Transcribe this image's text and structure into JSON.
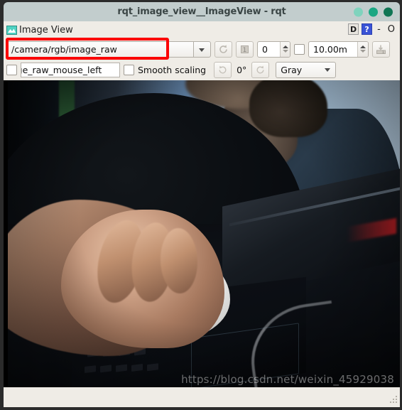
{
  "window": {
    "title": "rqt_image_view__ImageView - rqt",
    "controls": [
      {
        "name": "minimize",
        "color": "#7fd3bd"
      },
      {
        "name": "maximize",
        "color": "#1aa783"
      },
      {
        "name": "close",
        "color": "#0f7554"
      }
    ]
  },
  "dock": {
    "icon": "image-view-icon",
    "title": "Image View",
    "buttons": {
      "detach_label": "D",
      "help_label": "?",
      "minimize_label": "-",
      "close_label": "O"
    }
  },
  "toolbar_row1": {
    "topic_combo": {
      "value": "/camera/rgb/image_raw",
      "placeholder": "/camera/rgb/image_raw"
    },
    "refresh_button": "refresh-topics-icon",
    "publish_button": "publish-icon",
    "index_spin": {
      "value": "0"
    },
    "dynamic_range_checkbox": {
      "checked": false,
      "label": ""
    },
    "max_range_spin": {
      "value": "10.00m"
    },
    "save_button": "save-image-icon"
  },
  "toolbar_row2": {
    "mouse_publish_checkbox": {
      "checked": false
    },
    "mouse_topic_field": {
      "value": "age_raw_mouse_left",
      "full_value": "/camera/rgb/image_raw_mouse_left"
    },
    "smooth_scaling_checkbox": {
      "checked": false,
      "label": "Smooth scaling"
    },
    "rotate_left_button": "rotate-left-icon",
    "rotation_label": "0°",
    "rotate_right_button": "rotate-right-icon",
    "colormap_combo": {
      "value": "Gray"
    }
  },
  "image_view": {
    "description": "Webcam photo: person in dark hoodie with hand on a white computer mouse resting on a dark laptop keyboard",
    "watermark": "https://blog.csdn.net/weixin_45929038"
  },
  "annotation": {
    "type": "red-highlight-rectangle",
    "color": "#fb0505",
    "target": "topic-combo"
  },
  "statusbar": {
    "text": "",
    "size_grip": "resize-grip-icon"
  },
  "colors": {
    "titlebar": "#c2cdcd",
    "client_bg": "#efece6",
    "accent_blue": "#3a53d6",
    "annotation_red": "#fb0505"
  }
}
